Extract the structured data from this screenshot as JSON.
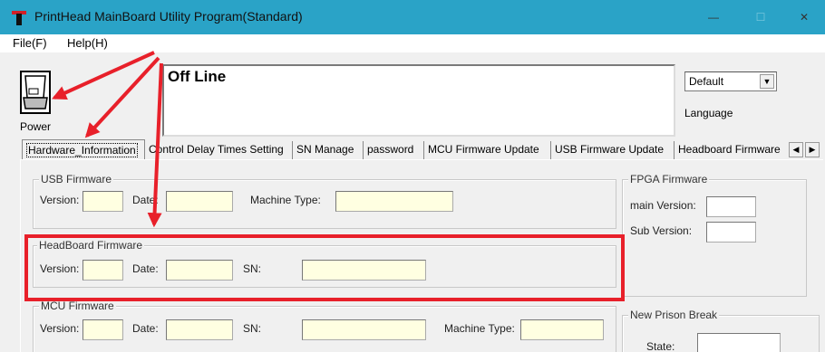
{
  "window": {
    "title": "PrintHead MainBoard Utility Program(Standard)",
    "minimize": "—",
    "maximize": "☐",
    "close": "✕"
  },
  "menu": {
    "file": "File(F)",
    "help": "Help(H)"
  },
  "power": {
    "label": "Power"
  },
  "status": {
    "text": "Off Line"
  },
  "language": {
    "selected": "Default",
    "label": "Language"
  },
  "tabs": [
    "Hardware_Information",
    "Control Delay Times Setting",
    "SN Manage",
    "password",
    "MCU Firmware Update",
    "USB Firmware Update",
    "Headboard Firmware"
  ],
  "usb_firmware": {
    "title": "USB Firmware",
    "version_label": "Version:",
    "date_label": "Date:",
    "machine_type_label": "Machine Type:"
  },
  "headboard_firmware": {
    "title": "HeadBoard Firmware",
    "version_label": "Version:",
    "date_label": "Date:",
    "sn_label": "SN:"
  },
  "mcu_firmware": {
    "title": "MCU  Firmware",
    "version_label": "Version:",
    "date_label": "Date:",
    "sn_label": "SN:",
    "machine_type_label": "Machine Type:"
  },
  "fpga_firmware": {
    "title": "FPGA Firmware",
    "main_version_label": "main Version:",
    "sub_version_label": "Sub Version:"
  },
  "prison_break": {
    "title": "New Prison Break",
    "state_label": "State:"
  },
  "colors": {
    "titlebar": "#2aa3c7",
    "field_bg": "#ffffe1",
    "annotation": "#e8202a"
  },
  "annotation": {
    "arrow_count": 3
  }
}
